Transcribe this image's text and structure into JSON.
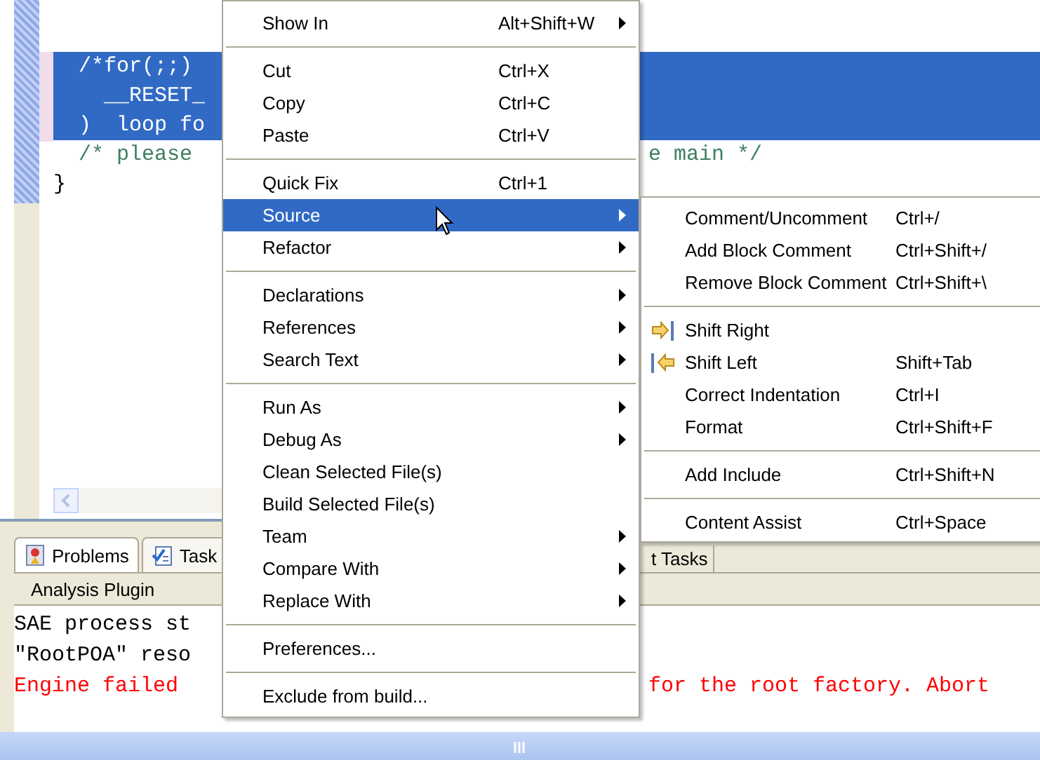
{
  "editor": {
    "lines": [
      {
        "left": "  /*for(;;)",
        "kind": "comment",
        "selected": true
      },
      {
        "left": "    __RESET_",
        "kind": "code",
        "selected": true
      },
      {
        "left": "  )  loop fo",
        "kind": "code",
        "selected": true
      },
      {
        "left": "  /* please",
        "right": "e main */",
        "kind": "comment",
        "selected": false
      },
      {
        "left": "}",
        "kind": "code",
        "selected": false
      }
    ]
  },
  "panel": {
    "tabs": [
      {
        "label": "Problems",
        "selected": true
      },
      {
        "label": "Task",
        "selected": false
      }
    ],
    "right_tab": "t Tasks",
    "header": "Analysis Plugin",
    "console": [
      {
        "left": "SAE process st",
        "kind": "info"
      },
      {
        "left": "\"RootPOA\" reso",
        "kind": "info"
      },
      {
        "left": "Engine failed",
        "right": "for the root factory. Abort",
        "kind": "error"
      }
    ]
  },
  "context_menu": {
    "items": [
      {
        "kind": "item",
        "label": "Show In",
        "shortcut": "Alt+Shift+W",
        "submenu": true,
        "selected": false
      },
      {
        "kind": "separator"
      },
      {
        "kind": "item",
        "label": "Cut",
        "shortcut": "Ctrl+X",
        "submenu": false,
        "selected": false
      },
      {
        "kind": "item",
        "label": "Copy",
        "shortcut": "Ctrl+C",
        "submenu": false,
        "selected": false
      },
      {
        "kind": "item",
        "label": "Paste",
        "shortcut": "Ctrl+V",
        "submenu": false,
        "selected": false
      },
      {
        "kind": "separator"
      },
      {
        "kind": "item",
        "label": "Quick Fix",
        "shortcut": "Ctrl+1",
        "submenu": false,
        "selected": false
      },
      {
        "kind": "item",
        "label": "Source",
        "submenu": true,
        "selected": true
      },
      {
        "kind": "item",
        "label": "Refactor",
        "submenu": true,
        "selected": false
      },
      {
        "kind": "separator"
      },
      {
        "kind": "item",
        "label": "Declarations",
        "submenu": true,
        "selected": false
      },
      {
        "kind": "item",
        "label": "References",
        "submenu": true,
        "selected": false
      },
      {
        "kind": "item",
        "label": "Search Text",
        "submenu": true,
        "selected": false
      },
      {
        "kind": "separator"
      },
      {
        "kind": "item",
        "label": "Run As",
        "submenu": true,
        "selected": false
      },
      {
        "kind": "item",
        "label": "Debug As",
        "submenu": true,
        "selected": false
      },
      {
        "kind": "item",
        "label": "Clean Selected File(s)",
        "submenu": false,
        "selected": false
      },
      {
        "kind": "item",
        "label": "Build Selected File(s)",
        "submenu": false,
        "selected": false
      },
      {
        "kind": "item",
        "label": "Team",
        "submenu": true,
        "selected": false
      },
      {
        "kind": "item",
        "label": "Compare With",
        "submenu": true,
        "selected": false
      },
      {
        "kind": "item",
        "label": "Replace With",
        "submenu": true,
        "selected": false
      },
      {
        "kind": "separator"
      },
      {
        "kind": "item",
        "label": "Preferences...",
        "submenu": false,
        "selected": false
      },
      {
        "kind": "separator"
      },
      {
        "kind": "item",
        "label": "Exclude from build...",
        "submenu": false,
        "selected": false
      }
    ]
  },
  "source_submenu": {
    "items": [
      {
        "kind": "item",
        "label": "Comment/Uncomment",
        "shortcut": "Ctrl+/"
      },
      {
        "kind": "item",
        "label": "Add Block Comment",
        "shortcut": "Ctrl+Shift+/"
      },
      {
        "kind": "item",
        "label": "Remove Block Comment",
        "shortcut": "Ctrl+Shift+\\"
      },
      {
        "kind": "separator"
      },
      {
        "kind": "shift_right",
        "label": "Shift Right"
      },
      {
        "kind": "shift_left",
        "label": "Shift Left",
        "shortcut": "Shift+Tab"
      },
      {
        "kind": "item",
        "label": "Correct Indentation",
        "shortcut": "Ctrl+I"
      },
      {
        "kind": "item",
        "label": "Format",
        "shortcut": "Ctrl+Shift+F"
      },
      {
        "kind": "separator"
      },
      {
        "kind": "item",
        "label": "Add Include",
        "shortcut": "Ctrl+Shift+N"
      },
      {
        "kind": "separator"
      },
      {
        "kind": "item",
        "label": "Content Assist",
        "shortcut": "Ctrl+Space"
      }
    ]
  }
}
